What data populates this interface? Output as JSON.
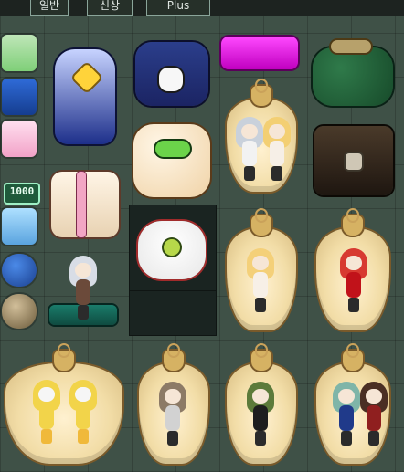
{
  "tabs": [
    "일반",
    "신상",
    "Plus"
  ],
  "badge": {
    "text": "1000"
  },
  "colors": {
    "panel_bg": "#3f5147",
    "tabbar_bg": "#1d2320",
    "slot_dark": "#1a2421",
    "sack_fill": "#f2dda7",
    "sack_outline": "#7a5a2a"
  },
  "items": [
    {
      "name": "star-backpack-icon"
    },
    {
      "name": "bunny-bag-icon"
    },
    {
      "name": "pink-clutch-icon"
    },
    {
      "name": "green-coin-purse-icon"
    },
    {
      "name": "cat-plush-bag-icon"
    },
    {
      "name": "gift-box-icon"
    },
    {
      "name": "flower-pouch-icon"
    },
    {
      "name": "treasure-trunk-icon"
    },
    {
      "name": "character-sack-icon"
    }
  ]
}
